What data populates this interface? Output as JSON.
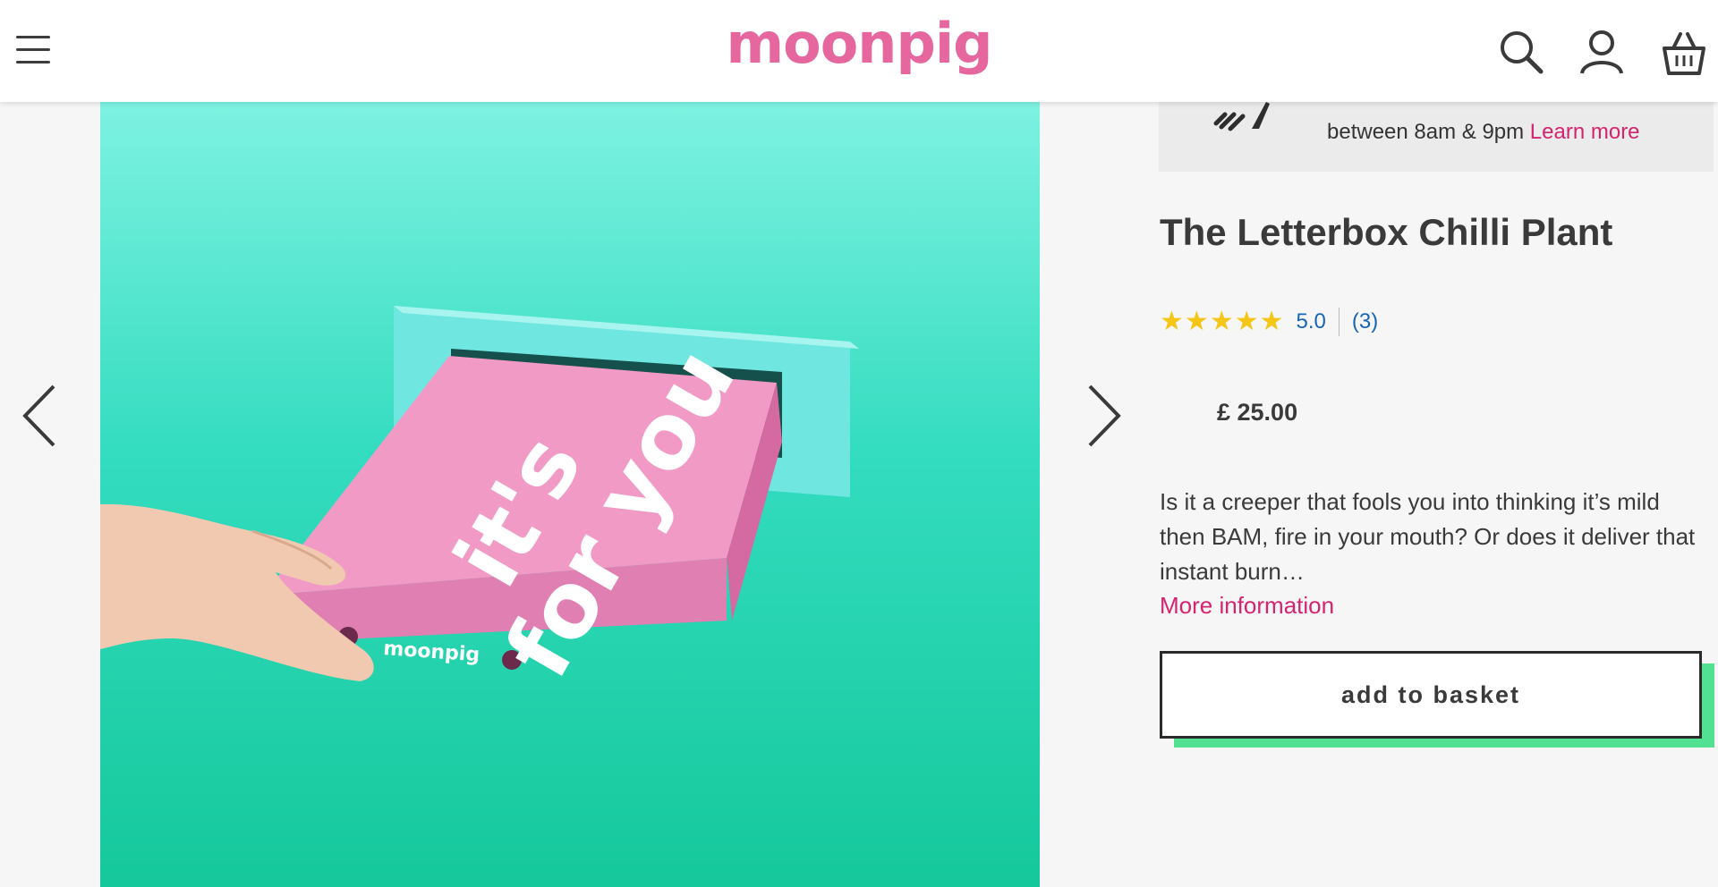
{
  "header": {
    "logo": "moonpig",
    "menu_icon": "hamburger-menu-icon",
    "search_icon": "search-icon",
    "account_icon": "user-icon",
    "basket_icon": "basket-icon"
  },
  "gallery": {
    "prev_icon": "chevron-left-icon",
    "next_icon": "chevron-right-icon",
    "image_text": {
      "box_slogan_line1": "it's",
      "box_slogan_line2": "for you",
      "box_brand": "moonpig"
    },
    "colors": {
      "background": "#2bd9b0",
      "box": "#f29ac6",
      "letterbox": "#6fe6e0"
    }
  },
  "promo": {
    "text": "between 8am & 9pm",
    "link": "Learn more"
  },
  "product": {
    "title": "The Letterbox Chilli Plant",
    "rating_score": "5.0",
    "rating_count": "(3)",
    "rating_stars": 5,
    "price": "£ 25.00",
    "description": "Is it a creeper that fools you into thinking it’s mild then BAM, fire in your mouth? Or does it deliver that instant burn…",
    "more_info": "More information",
    "add_to_basket": "add to basket"
  },
  "colors": {
    "brand_pink": "#e5679e",
    "link_pink": "#d4246f",
    "rating_blue": "#1965b5",
    "star": "#f5c518",
    "button_shadow": "#52e092"
  }
}
